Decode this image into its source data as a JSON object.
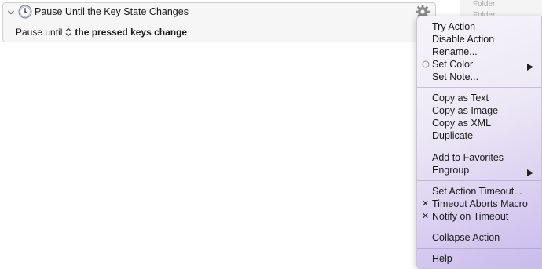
{
  "side_panel": {
    "items": [
      "Folder",
      "Folder"
    ]
  },
  "action": {
    "title": "Pause Until the Key State Changes",
    "param_label": "Pause until",
    "param_value": "the pressed keys change"
  },
  "menu": {
    "group1": {
      "try_action": "Try Action",
      "disable_action": "Disable Action",
      "rename": "Rename...",
      "set_color": "Set Color",
      "set_note": "Set Note..."
    },
    "group2": {
      "copy_as_text": "Copy as Text",
      "copy_as_image": "Copy as Image",
      "copy_as_xml": "Copy as XML",
      "duplicate": "Duplicate"
    },
    "group3": {
      "add_to_favorites": "Add to Favorites",
      "engroup": "Engroup"
    },
    "group4": {
      "set_action_timeout": "Set Action Timeout...",
      "timeout_aborts_macro": "Timeout Aborts Macro",
      "notify_on_timeout": "Notify on Timeout"
    },
    "group5": {
      "collapse_action": "Collapse Action"
    },
    "group6": {
      "help": "Help"
    },
    "check_mark": "✕"
  },
  "icons": {
    "disclosure": "chevron-down-icon",
    "action": "clock-icon",
    "gear": "gear-icon",
    "popup": "up-down-arrows-icon",
    "submenu": "submenu-arrow-icon",
    "color": "circle-icon"
  },
  "colors": {
    "menu_tint": "#c8baec",
    "action_background": "#f6f6f6"
  }
}
